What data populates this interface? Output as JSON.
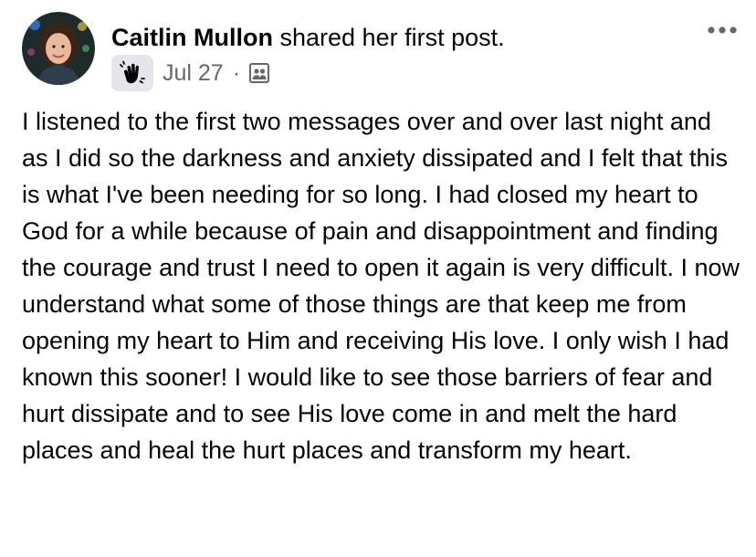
{
  "post": {
    "author_name": "Caitlin Mullon",
    "action_text": "shared her first post.",
    "date": "Jul 27",
    "separator": "·",
    "badge_icon": "hand-wave-icon",
    "audience_icon": "group-members-icon",
    "more_icon": "more-options-icon",
    "text": "I listened to the first two messages over and over last night and as I did so the darkness and anxiety dissipated and I felt that this is what I've been needing for so long. I had closed my heart to God for a while because of pain and disappointment and finding the courage and trust I need to open it again is very difficult. I now understand what some of those things are that keep me from opening my heart to Him and receiving His love. I only wish I had known this sooner! I would like to see those barriers of fear and hurt dissipate and to see His love come in and melt the hard places and heal the hurt places and transform my heart."
  },
  "colors": {
    "text_primary": "#050505",
    "text_secondary": "#65676b",
    "badge_background": "#e4e6eb"
  }
}
